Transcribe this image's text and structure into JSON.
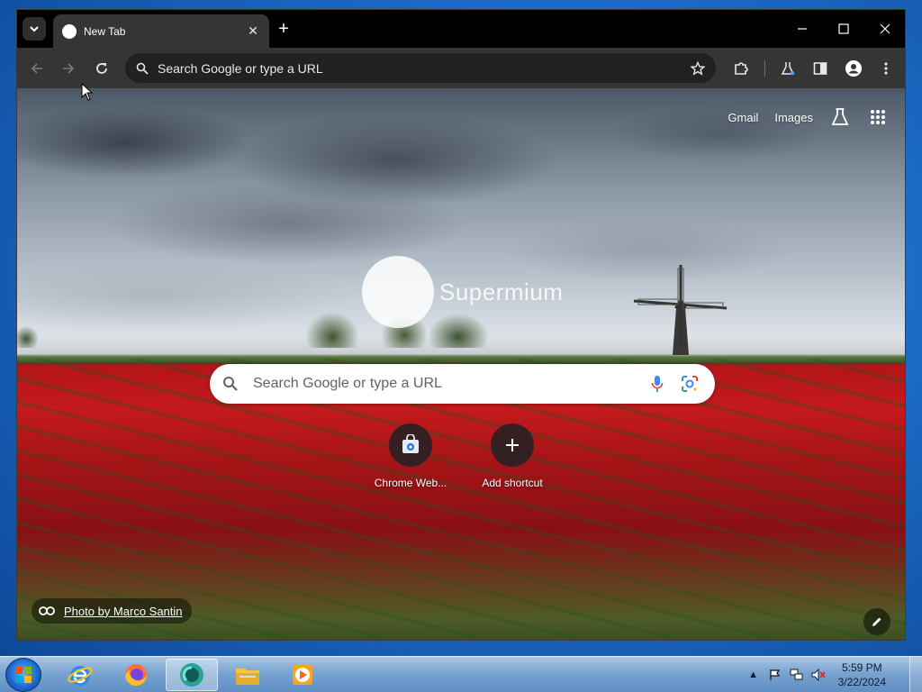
{
  "window": {
    "tab_title": "New Tab",
    "tab_close": "✕",
    "new_tab": "+"
  },
  "toolbar": {
    "omnibox_text": "Search Google or type a URL"
  },
  "page": {
    "top_links": {
      "gmail": "Gmail",
      "images": "Images"
    },
    "logo_text": "Supermium",
    "search_placeholder": "Search Google or type a URL",
    "shortcuts": [
      {
        "label": "Chrome Web..."
      },
      {
        "label": "Add shortcut"
      }
    ],
    "photo_credit": "Photo by Marco Santin"
  },
  "taskbar": {
    "time": "5:59 PM",
    "date": "3/22/2024",
    "tray_arrow": "▲",
    "apps": [
      "internet-explorer",
      "firefox",
      "supermium",
      "file-explorer",
      "media-player"
    ]
  },
  "colors": {
    "tab_bg": "#353535",
    "toolbar_bg": "#353535",
    "omnibox_bg": "#212121",
    "titlebar_bg": "#000000"
  }
}
